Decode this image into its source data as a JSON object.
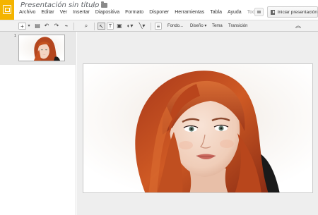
{
  "document": {
    "title": "Presentación sin título"
  },
  "menu": {
    "items": [
      "Archivo",
      "Editar",
      "Ver",
      "Insertar",
      "Diapositiva",
      "Formato",
      "Disponer",
      "Herramientas",
      "Tabla",
      "Ayuda"
    ],
    "all_changes": "Todo..."
  },
  "header": {
    "present_label": "Iniciar presentación"
  },
  "toolbar": {
    "background_label": "Fondo...",
    "layout_label": "Diseño",
    "theme_label": "Tema",
    "transition_label": "Transición"
  },
  "filmstrip": {
    "slide_number": "1"
  },
  "icons": [
    "slides-logo-icon",
    "star-icon",
    "folder-icon",
    "comment-icon",
    "play-icon",
    "new-slide-icon",
    "dropdown-icon",
    "print-icon",
    "undo-icon",
    "redo-icon",
    "paint-format-icon",
    "zoom-icon",
    "cursor-icon",
    "textbox-icon",
    "image-icon",
    "shape-icon",
    "line-icon",
    "comment-add-icon",
    "collapse-icon"
  ],
  "colors": {
    "brand": "#f4b400",
    "toolbar_bg": "#f1f1f1",
    "canvas_bg": "#eeeeee",
    "selected_thumb_bg": "#e8e8e8"
  }
}
